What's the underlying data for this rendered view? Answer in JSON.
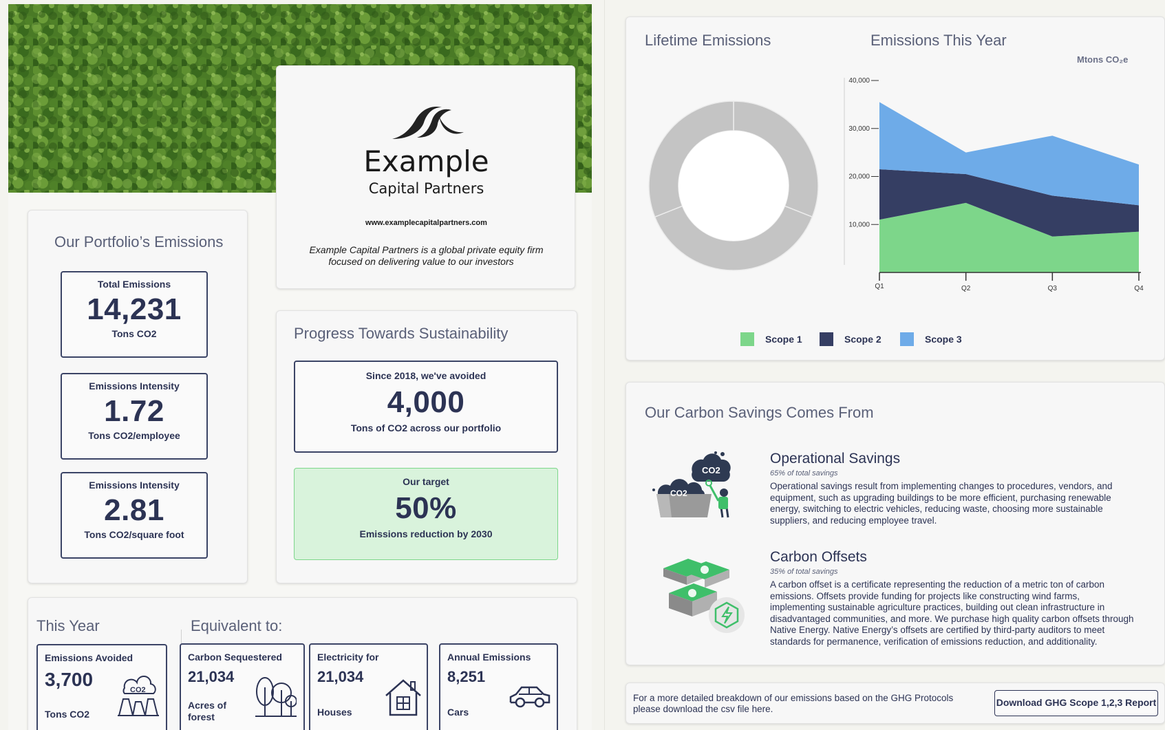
{
  "brand": {
    "name": "Example",
    "subtitle": "Capital Partners",
    "url": "www.examplecapitalpartners.com",
    "tagline_line1": "Example Capital Partners is a global private equity firm",
    "tagline_line2": "focused on delivering value to our investors"
  },
  "portfolio": {
    "heading": "Our Portfolio’s Emissions",
    "stats": [
      {
        "label": "Total Emissions",
        "value": "14,231",
        "unit": "Tons CO2"
      },
      {
        "label": "Emissions Intensity",
        "value": "1.72",
        "unit": "Tons CO2/employee"
      },
      {
        "label": "Emissions Intensity",
        "value": "2.81",
        "unit": "Tons CO2/square foot"
      }
    ]
  },
  "progress": {
    "heading": "Progress Towards Sustainability",
    "avoided": {
      "label": "Since 2018, we've avoided",
      "value": "4,000",
      "unit": "Tons of CO2 across our portfolio"
    },
    "target": {
      "label": "Our target",
      "value": "50%",
      "unit": "Emissions reduction by 2030"
    }
  },
  "this_year": {
    "heading": "This Year",
    "equiv_heading": "Equivalent to:",
    "cards": [
      {
        "label": "Emissions Avoided",
        "value": "3,700",
        "unit": "Tons CO2",
        "icon": "factory-co2-icon"
      },
      {
        "label": "Carbon Sequestered",
        "value": "21,034",
        "unit_line1": "Acres of",
        "unit_line2": "forest",
        "icon": "trees-icon"
      },
      {
        "label": "Electricity for",
        "value": "21,034",
        "unit": "Houses",
        "icon": "house-icon"
      },
      {
        "label": "Annual Emissions",
        "value": "8,251",
        "unit": "Cars",
        "icon": "car-icon"
      }
    ]
  },
  "lifetime": {
    "heading": "Lifetime Emissions"
  },
  "this_year_chart": {
    "heading": "Emissions This Year",
    "unit_label": "Mtons CO₂e"
  },
  "chart_data": [
    {
      "type": "pie",
      "variant": "donut",
      "title": "Lifetime Emissions",
      "slices": [
        {
          "label": "",
          "value": 31
        },
        {
          "label": "",
          "value": 38
        },
        {
          "label": "",
          "value": 31
        }
      ],
      "colors": [
        "#c4c4c4",
        "#c4c4c4",
        "#c4c4c4"
      ]
    },
    {
      "type": "area",
      "stacked": true,
      "title": "Emissions This Year",
      "ylabel": "Mtons CO₂e",
      "categories": [
        "Q1",
        "Q2",
        "Q3",
        "Q4"
      ],
      "ylim": [
        0,
        40000
      ],
      "yticks": [
        "10,000",
        "20,000",
        "30,000",
        "40,000"
      ],
      "legend_position": "bottom",
      "series": [
        {
          "name": "Scope 1",
          "color": "#7dd68a",
          "values": [
            11000,
            14500,
            7500,
            8500
          ]
        },
        {
          "name": "Scope 2",
          "color": "#353e63",
          "values": [
            10500,
            6000,
            8500,
            5500
          ]
        },
        {
          "name": "Scope 3",
          "color": "#6eabe8",
          "values": [
            14000,
            4500,
            12500,
            8500
          ]
        }
      ]
    }
  ],
  "savings": {
    "heading": "Our Carbon Savings Comes From",
    "items": [
      {
        "title": "Operational Savings",
        "sub": "65% of total savings",
        "lines": [
          "Operational savings result from implementing changes to procedures, vendors, and",
          "equipment, such as upgrading buildings to be more efficient, purchasing renewable",
          "energy, switching to electric vehicles, reducing waste, choosing more sustainable",
          "suppliers, and reducing employee travel."
        ],
        "icon": "co2-clouds-person-icon"
      },
      {
        "title": "Carbon Offsets",
        "sub": "35% of total savings",
        "lines": [
          "A carbon offset is a certificate representing the reduction of a metric ton of carbon",
          "emissions. Offsets provide funding for projects like constructing wind farms,",
          "implementing sustainable agriculture practices, building out clean infrastructure in",
          "disadvantaged communities, and more. We purchase high quality carbon offsets through",
          "Native Energy. Native Energy’s offsets are certified by third-party auditors to meet",
          "standards for permanence, verification of emissions reduction, and additionality."
        ],
        "icon": "money-stack-icon"
      }
    ]
  },
  "footer": {
    "line1": "For a more detailed breakdown of our emissions based on the GHG Protocols",
    "line2": "please download the csv file here.",
    "button": "Download GHG Scope 1,2,3 Report"
  },
  "icons": {
    "co2_text": "CO2"
  }
}
